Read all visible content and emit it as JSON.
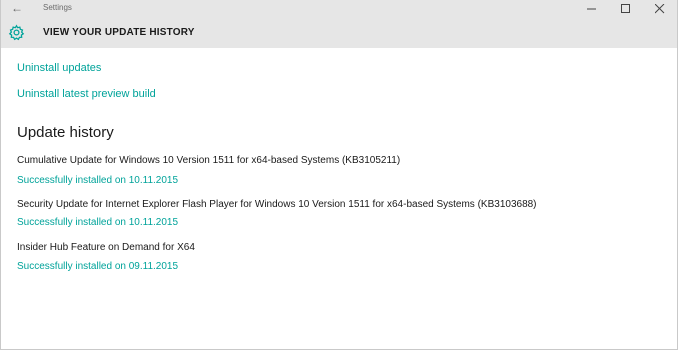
{
  "window": {
    "title": "Settings"
  },
  "header": {
    "title": "VIEW YOUR UPDATE HISTORY",
    "icon": "gear-icon",
    "accent": "#00a39a"
  },
  "links": {
    "uninstall_updates": "Uninstall updates",
    "uninstall_preview": "Uninstall latest preview build"
  },
  "history": {
    "heading": "Update history",
    "items": [
      {
        "title": "Cumulative Update for Windows 10 Version 1511 for x64-based Systems (KB3105211)",
        "status": "Successfully installed on 10.11.2015"
      },
      {
        "title": "Security Update for Internet Explorer Flash Player for Windows 10 Version 1511 for x64-based Systems (KB3103688)",
        "status": "Successfully installed on 10.11.2015"
      },
      {
        "title": "Insider Hub Feature on Demand for X64",
        "status": "Successfully installed on 09.11.2015"
      }
    ]
  }
}
